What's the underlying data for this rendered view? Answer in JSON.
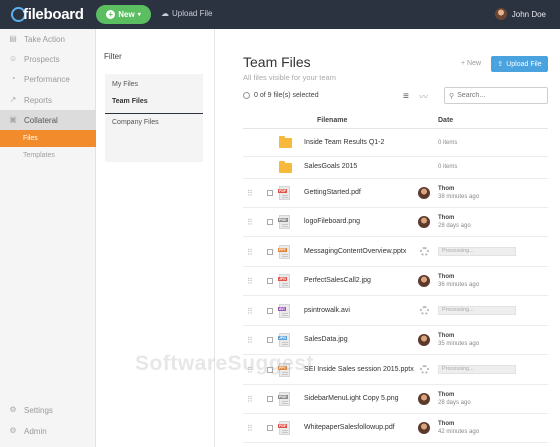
{
  "brand": {
    "logo_text": "fileboard"
  },
  "header": {
    "new_label": "New",
    "upload_label": "Upload File",
    "user_name": "John Doe"
  },
  "nav": {
    "items": [
      {
        "label": "Take Action",
        "icon": "list-icon"
      },
      {
        "label": "Prospects",
        "icon": "users-icon"
      },
      {
        "label": "Performance",
        "icon": "dashboard-icon"
      },
      {
        "label": "Reports",
        "icon": "chart-icon"
      },
      {
        "label": "Collateral",
        "icon": "collateral-icon"
      }
    ],
    "sub": [
      {
        "label": "Files"
      },
      {
        "label": "Templates"
      }
    ],
    "bottom": [
      {
        "label": "Settings",
        "icon": "gear-icon"
      },
      {
        "label": "Admin",
        "icon": "admin-icon"
      }
    ]
  },
  "filter": {
    "title": "Filter",
    "options": [
      "My Files",
      "Team Files",
      "Company Files"
    ]
  },
  "main": {
    "title": "Team Files",
    "subtitle": "All files visible for your team",
    "new_label": "+ New",
    "upload_label": "Upload File",
    "selection": "0 of 9 file(s) selected",
    "search_placeholder": "Search...",
    "col_filename": "Filename",
    "col_date": "Date"
  },
  "rows": [
    {
      "kind": "folder",
      "name": "Inside Team Results Q1-2",
      "info": "0 items"
    },
    {
      "kind": "folder",
      "name": "SalesGoals 2015",
      "info": "0 items"
    },
    {
      "kind": "file",
      "type": "PDF",
      "color": "#e0534a",
      "name": "GettingStarted.pdf",
      "owner": "Thom",
      "ago": "38 minutes ago"
    },
    {
      "kind": "file",
      "type": "PNG",
      "color": "#8a8a8a",
      "name": "logoFileboard.png",
      "owner": "Thom",
      "ago": "28 days ago"
    },
    {
      "kind": "file",
      "type": "PPT",
      "color": "#e5873a",
      "name": "MessagingContentOverview.pptx",
      "processing": "Processing..."
    },
    {
      "kind": "file",
      "type": "JPG",
      "color": "#e0534a",
      "name": "PerfectSalesCall2.jpg",
      "owner": "Thom",
      "ago": "36 minutes ago"
    },
    {
      "kind": "file",
      "type": "AVI",
      "color": "#9b59b6",
      "name": "psintrowalk.avi",
      "processing": "Processing..."
    },
    {
      "kind": "file",
      "type": "JPG",
      "color": "#5aa1d8",
      "name": "SalesData.jpg",
      "owner": "Thom",
      "ago": "35 minutes ago"
    },
    {
      "kind": "file",
      "type": "PPT",
      "color": "#e5873a",
      "name": "SEI Inside Sales session 2015.pptx",
      "processing": "Processing..."
    },
    {
      "kind": "file",
      "type": "PNG",
      "color": "#8a8a8a",
      "name": "SidebarMenuLight Copy 5.png",
      "owner": "Thom",
      "ago": "28 days ago"
    },
    {
      "kind": "file",
      "type": "PDF",
      "color": "#e0534a",
      "name": "WhitepaperSalesfollowup.pdf",
      "owner": "Thom",
      "ago": "42 minutes ago"
    }
  ],
  "watermark": "SoftwareSuggest"
}
